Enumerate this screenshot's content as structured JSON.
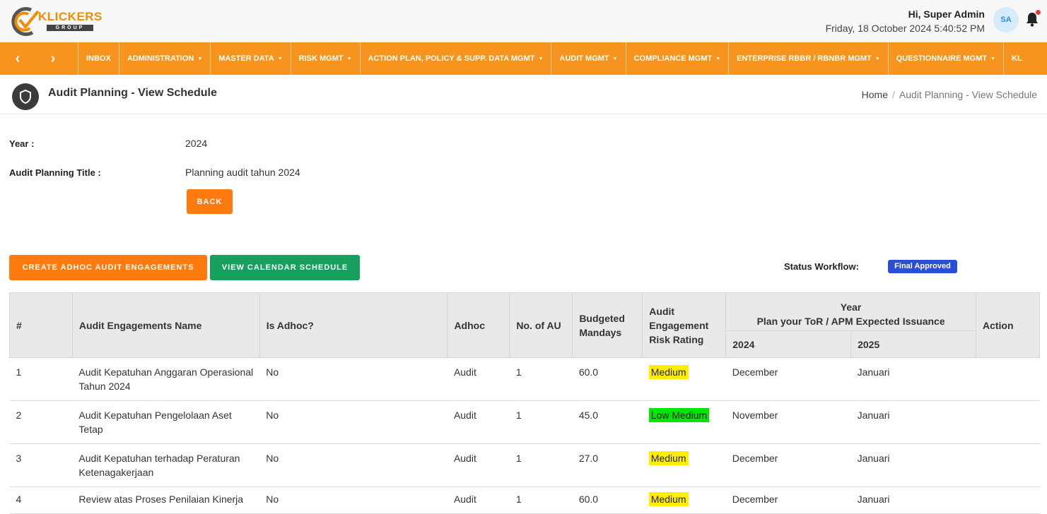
{
  "header": {
    "logo_text": "KLICKERS",
    "logo_subtext": "GROUP",
    "greeting": "Hi, Super Admin",
    "datetime": "Friday, 18 October 2024 5:40:52 PM",
    "avatar_initials": "SA",
    "notification_dot_color": "#e53935"
  },
  "nav": {
    "prev_icon": "chevron-left-icon",
    "next_icon": "chevron-right-icon",
    "items": [
      {
        "label": "INBOX",
        "dropdown": false
      },
      {
        "label": "ADMINISTRATION",
        "dropdown": true
      },
      {
        "label": "MASTER DATA",
        "dropdown": true
      },
      {
        "label": "RISK MGMT",
        "dropdown": true
      },
      {
        "label": "ACTION PLAN, POLICY & SUPP. DATA MGMT",
        "dropdown": true
      },
      {
        "label": "AUDIT MGMT",
        "dropdown": true
      },
      {
        "label": "COMPLIANCE MGMT",
        "dropdown": true
      },
      {
        "label": "ENTERPRISE RBBR / RBNBR MGMT",
        "dropdown": true
      },
      {
        "label": "QUESTIONNAIRE MGMT",
        "dropdown": true
      },
      {
        "label": "KL",
        "dropdown": false
      }
    ],
    "bg_color": "#f7941d"
  },
  "page": {
    "title": "Audit Planning - View Schedule",
    "breadcrumb": [
      "Home",
      "Audit Planning - View Schedule"
    ]
  },
  "info": {
    "year_label": "Year :",
    "year_value": "2024",
    "title_label": "Audit Planning Title :",
    "title_value": "Planning audit tahun 2024",
    "back_button": "BACK"
  },
  "actions": {
    "create_adhoc": "CREATE ADHOC AUDIT ENGAGEMENTS",
    "view_calendar": "VIEW CALENDAR SCHEDULE",
    "status_label": "Status Workflow:",
    "status_value": "Final Approved"
  },
  "table": {
    "headers": {
      "num": "#",
      "name": "Audit Engagements Name",
      "is_adhoc": "Is Adhoc?",
      "adhoc": "Adhoc",
      "no_au": "No. of AU",
      "mandays": "Budgeted Mandays",
      "risk": "Audit Engagement Risk Rating",
      "year_group_line1": "Year",
      "year_group_line2": "Plan your ToR / APM Expected Issuance",
      "year1": "2024",
      "year2": "2025",
      "action": "Action"
    },
    "rows": [
      {
        "num": "1",
        "name": "Audit Kepatuhan Anggaran Operasional Tahun 2024",
        "is_adhoc": "No",
        "adhoc": "Audit",
        "no_au": "1",
        "mandays": "60.0",
        "risk": "Medium",
        "risk_color": "#ffee00",
        "y2024": "December",
        "y2025": "Januari",
        "action": ""
      },
      {
        "num": "2",
        "name": "Audit Kepatuhan Pengelolaan Aset Tetap",
        "is_adhoc": "No",
        "adhoc": "Audit",
        "no_au": "1",
        "mandays": "45.0",
        "risk": "Low Medium",
        "risk_color": "#00e600",
        "y2024": "November",
        "y2025": "Januari",
        "action": ""
      },
      {
        "num": "3",
        "name": "Audit Kepatuhan terhadap Peraturan Ketenagakerjaan",
        "is_adhoc": "No",
        "adhoc": "Audit",
        "no_au": "1",
        "mandays": "27.0",
        "risk": "Medium",
        "risk_color": "#ffee00",
        "y2024": "December",
        "y2025": "Januari",
        "action": ""
      },
      {
        "num": "4",
        "name": "Review atas Proses Penilaian Kinerja",
        "is_adhoc": "No",
        "adhoc": "Audit",
        "no_au": "1",
        "mandays": "60.0",
        "risk": "Medium",
        "risk_color": "#ffee00",
        "y2024": "December",
        "y2025": "Januari",
        "action": ""
      }
    ]
  }
}
